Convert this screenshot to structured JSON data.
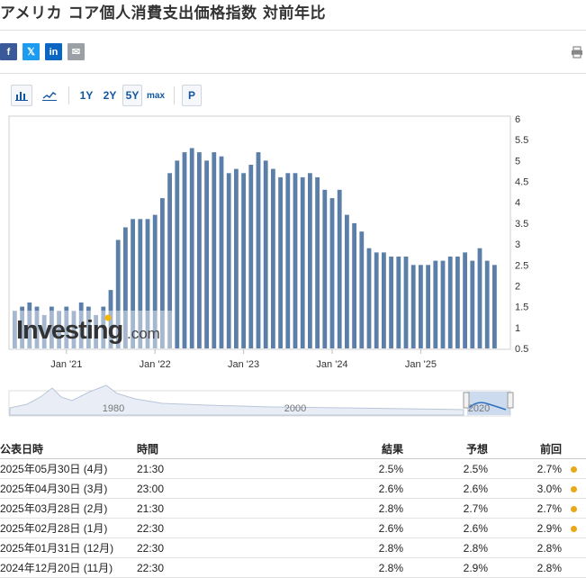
{
  "page": {
    "title": "アメリカ コア個人消費支出価格指数 対前年比"
  },
  "share": {
    "facebook": "f",
    "twitter": "𝕏",
    "linkedin": "in",
    "email": "✉",
    "colors": {
      "facebook": "#3b5998",
      "twitter": "#1d9bf0",
      "linkedin": "#0a66c2",
      "email": "#9aa0a6"
    }
  },
  "toolbar": {
    "range_1y": "1Y",
    "range_2y": "2Y",
    "range_5y": "5Y",
    "range_max": "max",
    "p_button": "P"
  },
  "watermark": {
    "brand": "Investing",
    "suffix": ".com"
  },
  "chart_data": {
    "type": "bar",
    "bar_color": "#5b7fa8",
    "x_tick_labels": [
      "Jan '21",
      "Jan '22",
      "Jan '23",
      "Jan '24",
      "Jan '25"
    ],
    "y_ticks": [
      "6",
      "5.5",
      "5",
      "4.5",
      "4",
      "3.5",
      "3",
      "2.5",
      "2",
      "1.5",
      "1",
      "0.5"
    ],
    "ylim": [
      0.5,
      6
    ],
    "values": [
      1.4,
      1.5,
      1.6,
      1.5,
      1.3,
      1.5,
      1.4,
      1.5,
      1.4,
      1.6,
      1.5,
      1.3,
      1.5,
      1.9,
      3.1,
      3.4,
      3.6,
      3.6,
      3.6,
      3.7,
      4.1,
      4.7,
      5.0,
      5.2,
      5.3,
      5.2,
      5.0,
      5.2,
      5.1,
      4.7,
      4.8,
      4.7,
      4.9,
      5.2,
      5.0,
      4.8,
      4.6,
      4.7,
      4.7,
      4.6,
      4.7,
      4.6,
      4.3,
      4.1,
      4.3,
      3.7,
      3.5,
      3.3,
      2.9,
      2.8,
      2.8,
      2.7,
      2.7,
      2.7,
      2.5,
      2.5,
      2.5,
      2.6,
      2.6,
      2.7,
      2.7,
      2.8,
      2.6,
      2.9,
      2.6,
      2.5
    ],
    "overview_labels": [
      "1980",
      "2000",
      "2020"
    ],
    "overview_color": "#4c8fd6"
  },
  "table": {
    "headers": [
      "公表日時",
      "時間",
      "結果",
      "予想",
      "前回"
    ],
    "rows": [
      {
        "date": "2025年05月30日 (4月)",
        "time": "21:30",
        "actual": "2.5%",
        "forecast": "2.5%",
        "previous": "2.7%",
        "actual_class": "",
        "prev_class": "red",
        "revised": true
      },
      {
        "date": "2025年04月30日 (3月)",
        "time": "23:00",
        "actual": "2.6%",
        "forecast": "2.6%",
        "previous": "3.0%",
        "actual_class": "",
        "prev_class": "red",
        "revised": true
      },
      {
        "date": "2025年03月28日 (2月)",
        "time": "21:30",
        "actual": "2.8%",
        "forecast": "2.7%",
        "previous": "2.7%",
        "actual_class": "red",
        "prev_class": "red",
        "revised": true
      },
      {
        "date": "2025年02月28日 (1月)",
        "time": "22:30",
        "actual": "2.6%",
        "forecast": "2.6%",
        "previous": "2.9%",
        "actual_class": "",
        "prev_class": "red",
        "revised": true
      },
      {
        "date": "2025年01月31日 (12月)",
        "time": "22:30",
        "actual": "2.8%",
        "forecast": "2.8%",
        "previous": "2.8%",
        "actual_class": "",
        "prev_class": "",
        "revised": false
      },
      {
        "date": "2024年12月20日 (11月)",
        "time": "22:30",
        "actual": "2.8%",
        "forecast": "2.9%",
        "previous": "2.8%",
        "actual_class": "green",
        "prev_class": "",
        "revised": false
      }
    ]
  }
}
